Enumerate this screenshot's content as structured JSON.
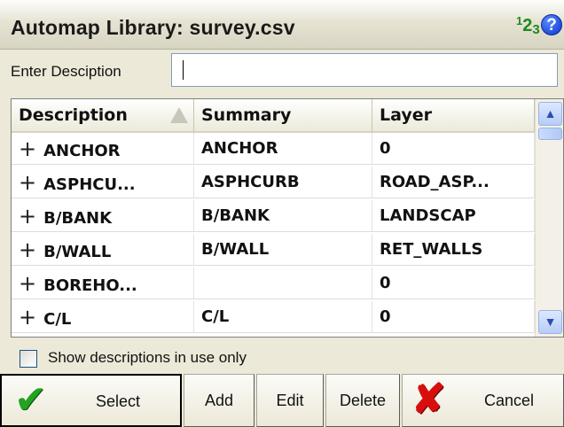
{
  "window": {
    "title": "Automap Library: survey.csv",
    "num_icon": {
      "one": "1",
      "two": "2",
      "three": "3"
    },
    "help_icon": "?"
  },
  "description_field": {
    "label": "Enter Desciption",
    "value": ""
  },
  "table": {
    "columns": [
      "Description",
      "Summary",
      "Layer"
    ],
    "sort_column": "Description",
    "rows": [
      {
        "description": "ANCHOR",
        "summary": "ANCHOR",
        "layer": "0"
      },
      {
        "description": "ASPHCU...",
        "summary": "ASPHCURB",
        "layer": "ROAD_ASP..."
      },
      {
        "description": "B/BANK",
        "summary": "B/BANK",
        "layer": "LANDSCAP"
      },
      {
        "description": "B/WALL",
        "summary": "B/WALL",
        "layer": "RET_WALLS"
      },
      {
        "description": "BOREHO...",
        "summary": "",
        "layer": "0"
      },
      {
        "description": "C/L",
        "summary": "C/L",
        "layer": "0"
      }
    ],
    "expand_glyph": "+"
  },
  "filter": {
    "label": "Show descriptions in use only",
    "checked": false
  },
  "buttons": {
    "select": "Select",
    "add": "Add",
    "edit": "Edit",
    "delete": "Delete",
    "cancel": "Cancel"
  },
  "colors": {
    "accent_green": "#22a322",
    "cancel_red": "#d80e0e",
    "help_blue": "#0b33c9"
  }
}
